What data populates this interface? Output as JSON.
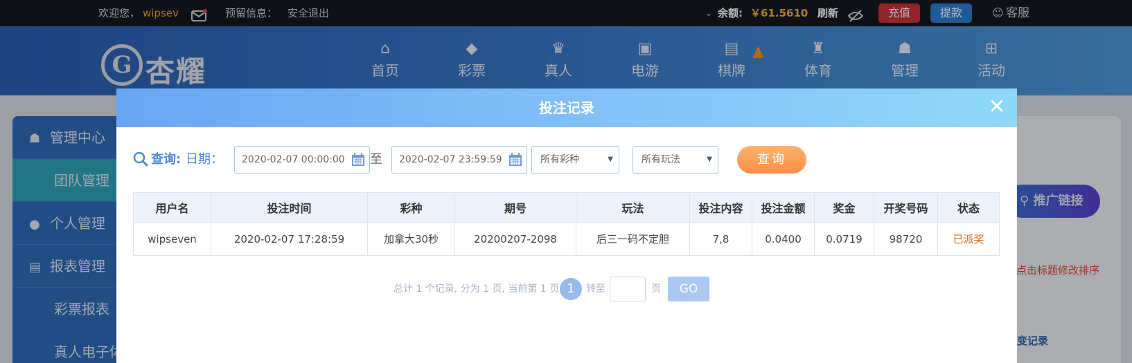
{
  "topbar": {
    "welcome": "欢迎您，",
    "username": "wipsev",
    "reserved_info": "预留信息：",
    "logout": "安全退出",
    "balance_label": "余额:",
    "balance_value": "￥61.5610",
    "refresh": "刷新",
    "recharge": "充值",
    "withdraw": "提款",
    "service": "客服",
    "icons": [
      "mail-icon",
      "eye-slash-icon",
      "chat-icon",
      "chevron-down-icon"
    ]
  },
  "header": {
    "logo_text": "杏耀",
    "nav": [
      {
        "label": "首页",
        "icon": "home-icon"
      },
      {
        "label": "彩票",
        "icon": "lottery-icon"
      },
      {
        "label": "真人",
        "icon": "live-dealer-icon"
      },
      {
        "label": "电游",
        "icon": "slot-machine-icon"
      },
      {
        "label": "棋牌",
        "icon": "cards-icon"
      },
      {
        "label": "体育",
        "icon": "trophy-icon"
      },
      {
        "label": "管理",
        "icon": "users-icon"
      },
      {
        "label": "活动",
        "icon": "gift-icon"
      }
    ]
  },
  "sidebar": {
    "items": [
      {
        "label": "管理中心",
        "icon": "users-icon"
      },
      {
        "label": "团队管理"
      },
      {
        "label": "个人管理",
        "icon": "user-icon"
      },
      {
        "label": "报表管理",
        "icon": "report-icon"
      },
      {
        "label": "彩票报表"
      },
      {
        "label": "真人电子体"
      }
    ]
  },
  "right_panel": {
    "promo_link": "推广链接",
    "sort_hint": "可点击标题修改排序",
    "link": "变记录"
  },
  "modal": {
    "title": "投注记录",
    "query_label": "查询:",
    "date_label": "日期：",
    "start_date": "2020-02-07 00:00:00",
    "to_label": "至",
    "end_date": "2020-02-07 23:59:59",
    "lottery_select": "所有彩种",
    "play_select": "所有玩法",
    "query_button": "查询",
    "table": {
      "headers": [
        "用户名",
        "投注时间",
        "彩种",
        "期号",
        "玩法",
        "投注内容",
        "投注金额",
        "奖金",
        "开奖号码",
        "状态"
      ],
      "rows": [
        [
          "wipseven",
          "2020-02-07 17:28:59",
          "加拿大30秒",
          "20200207-2098",
          "后三一码不定胆",
          "7,8",
          "0.0400",
          "0.0719",
          "98720",
          "已派奖"
        ]
      ]
    },
    "pagination": {
      "summary": "总计 1 个记录, 分为 1 页, 当前第 1 页",
      "current_page": "1",
      "goto_label": "转至",
      "page_label": "页",
      "go_button": "GO"
    }
  },
  "colors": {
    "accent_blue": "#4c87d9",
    "status_orange": "#d86a1e",
    "query_button": "#ff9a55",
    "recharge_red": "#c8323c",
    "withdraw_blue": "#2a7fd0"
  }
}
